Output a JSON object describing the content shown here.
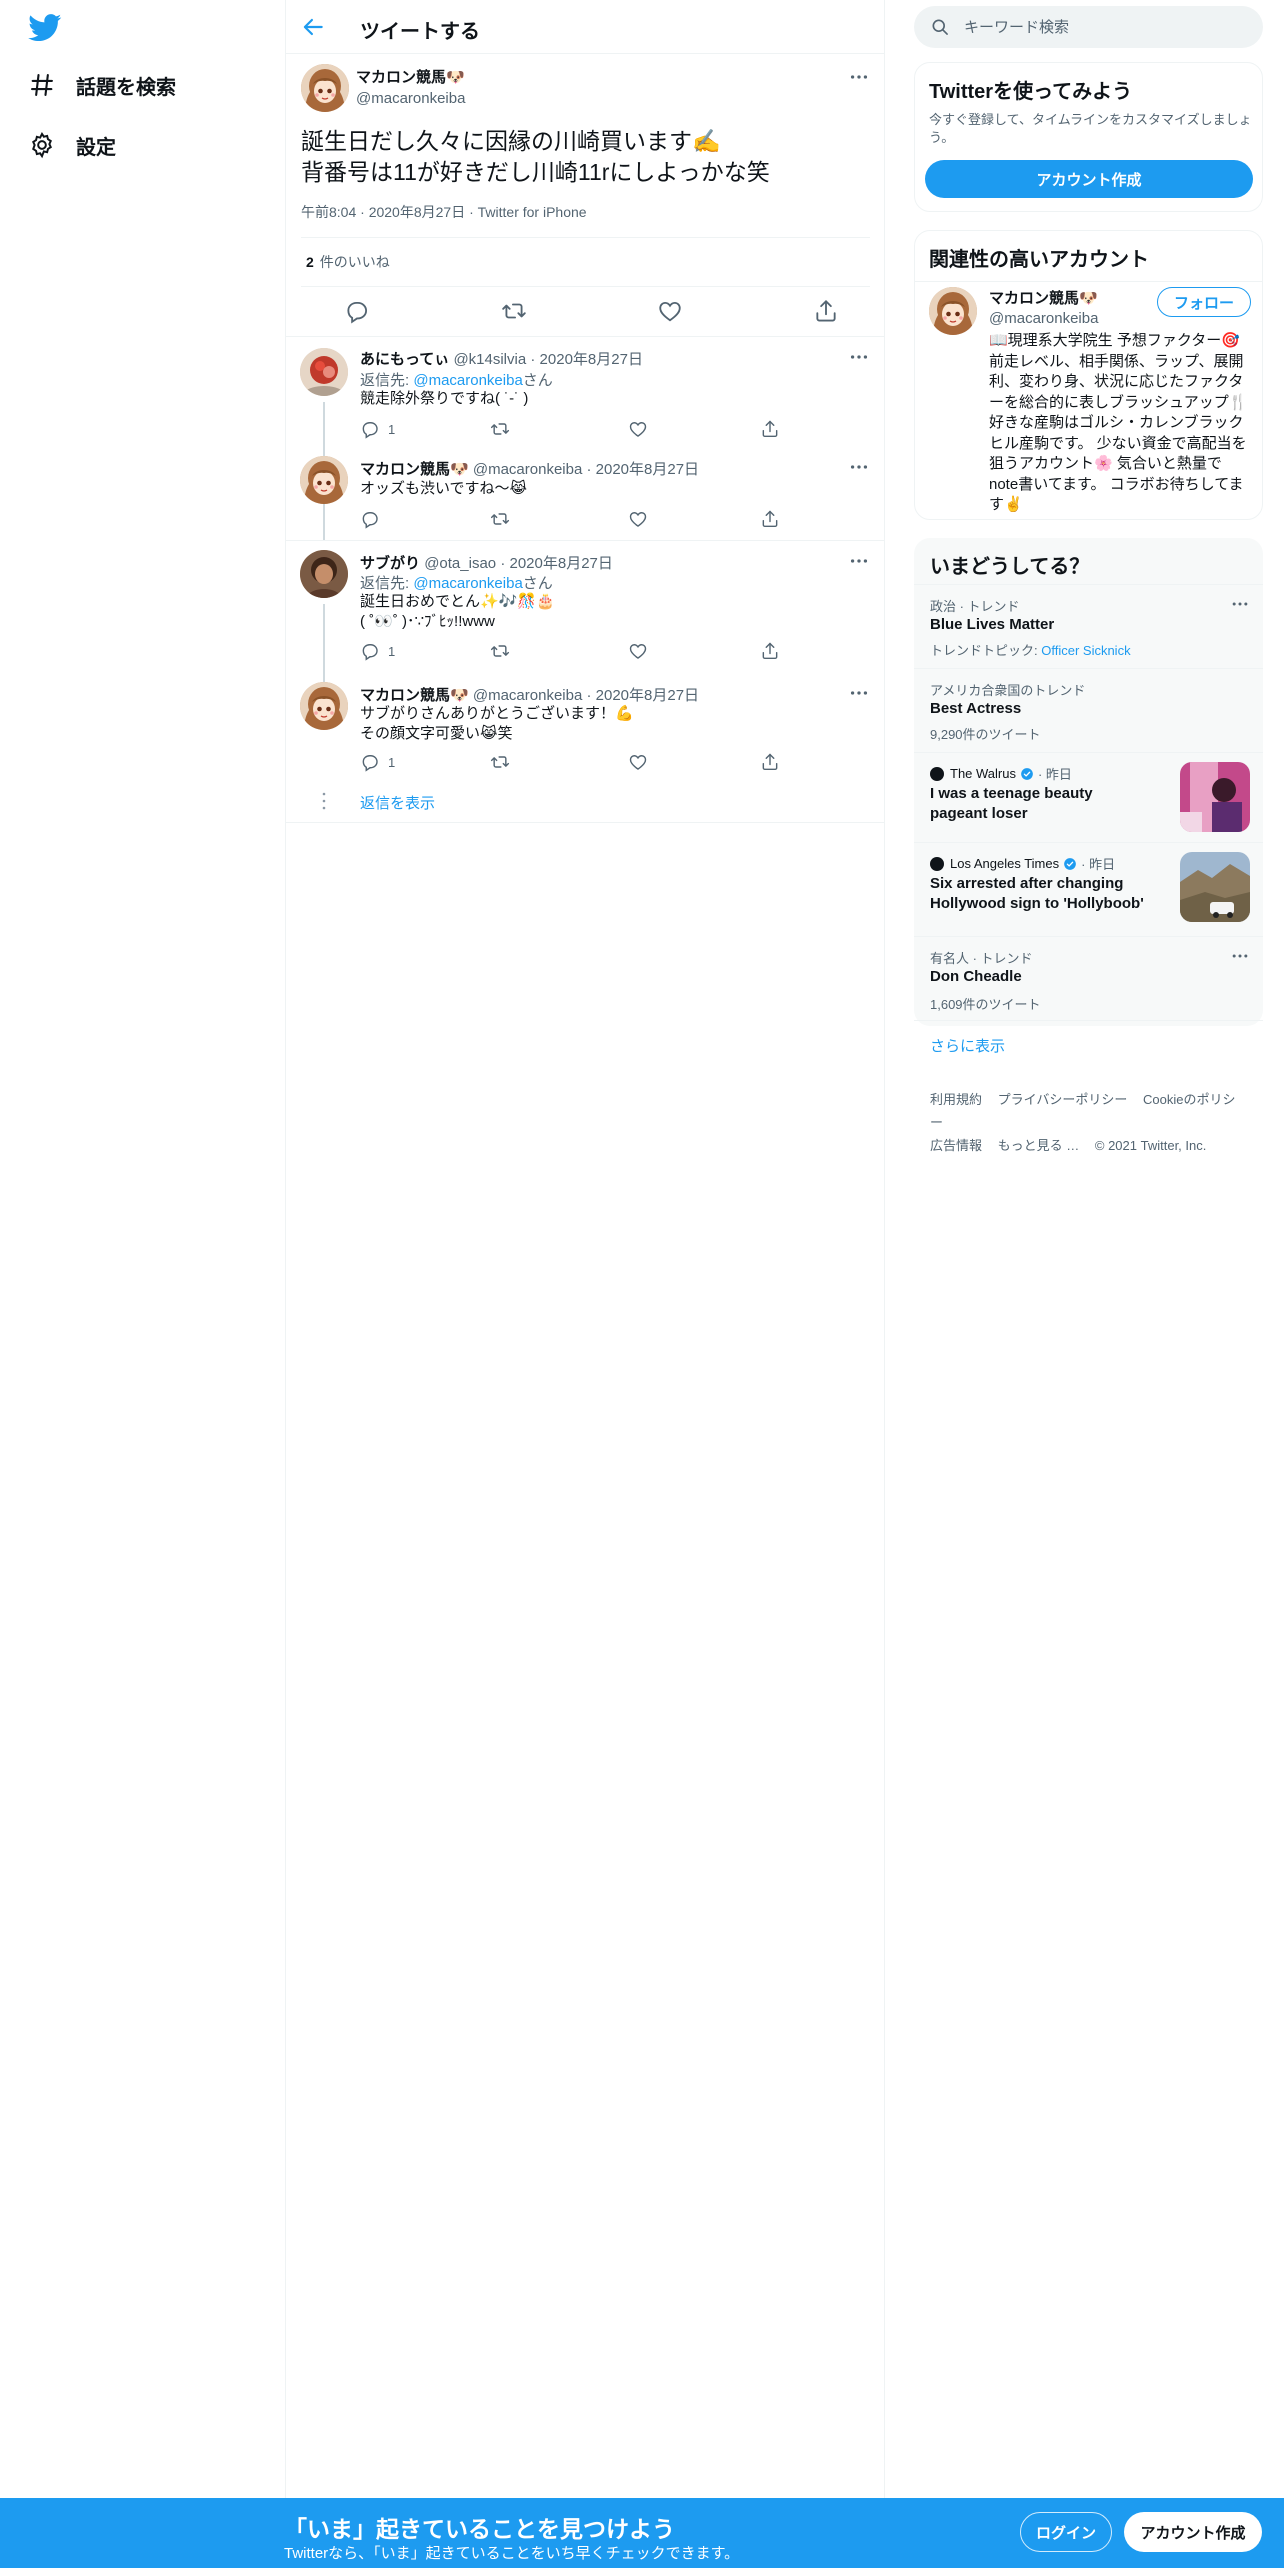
{
  "nav": {
    "explore_label": "話題を検索",
    "settings_label": "設定"
  },
  "header": {
    "title": "ツイートする"
  },
  "focus_tweet": {
    "name": "マカロン競馬🐶",
    "handle": "@macaronkeiba",
    "text_line1": "誕生日だし久々に因縁の川崎買います✍️",
    "text_line2": "背番号は11が好きだし川崎11rにしよっかな笑",
    "meta": "午前8:04 · 2020年8月27日 · Twitter for iPhone",
    "likes_count": "2",
    "likes_label": "件のいいね"
  },
  "replies": [
    {
      "name": "あにもってぃ",
      "handle": "@k14silvia",
      "date": "2020年8月27日",
      "reply_to_prefix": "返信先: ",
      "reply_to_handle": "@macaronkeiba",
      "reply_to_suffix": "さん",
      "text": "競走除外祭りですね( ˙-˙ )",
      "reply_count": "1"
    },
    {
      "name": "マカロン競馬🐶",
      "handle": "@macaronkeiba",
      "date": "2020年8月27日",
      "text": "オッズも渋いですね〜😹",
      "reply_count": ""
    },
    {
      "name": "サブがり",
      "handle": "@ota_isao",
      "date": "2020年8月27日",
      "reply_to_prefix": "返信先: ",
      "reply_to_handle": "@macaronkeiba",
      "reply_to_suffix": "さん",
      "text": "誕生日おめでとん✨🎶🎊🎂",
      "text2": "( ˚👀˚ )･∵ﾌﾞﾋｯ!!www",
      "reply_count": "1"
    },
    {
      "name": "マカロン競馬🐶",
      "handle": "@macaronkeiba",
      "date": "2020年8月27日",
      "text": "サブがりさんありがとうございます！💪",
      "text2": "その顔文字可愛い😹笑",
      "reply_count": "1"
    }
  ],
  "show_replies": "返信を表示",
  "search": {
    "placeholder": "キーワード検索"
  },
  "signup_card": {
    "title": "Twitterを使ってみよう",
    "desc": "今すぐ登録して、タイムラインをカスタマイズしましょう。",
    "button": "アカウント作成"
  },
  "related": {
    "title": "関連性の高いアカウント",
    "name": "マカロン競馬🐶",
    "handle": "@macaronkeiba",
    "follow": "フォロー",
    "bio": "📖現理系大学院生 予想ファクター🎯前走レベル、相手関係、ラップ、展開利、変わり身、状況に応じたファクターを総合的に表しブラッシュアップ🍴 好きな産駒はゴルシ・カレンブラックヒル産駒です。 少ない資金で高配当を狙うアカウント🌸 気合いと熱量でnote書いてます。 コラボお待ちしてます✌️"
  },
  "trends": {
    "title": "いまどうしてる？",
    "items": [
      {
        "context": "政治 · トレンド",
        "name": "Blue Lives Matter",
        "sub_prefix": "トレンドトピック: ",
        "sub_link": "Officer Sicknick"
      },
      {
        "context": "アメリカ合衆国のトレンド",
        "name": "Best Actress",
        "sub": "9,290件のツイート"
      },
      {
        "context": "有名人 · トレンド",
        "name": "Don Cheadle",
        "sub": "1,609件のツイート"
      }
    ],
    "news": [
      {
        "source": "The Walrus",
        "time": "· 昨日",
        "headline": "I was a teenage beauty pageant loser"
      },
      {
        "source": "Los Angeles Times",
        "time": "· 昨日",
        "headline": "Six arrested after changing Hollywood sign to 'Hollyboob'"
      }
    ],
    "show_more": "さらに表示"
  },
  "footer": {
    "links": [
      "利用規約",
      "プライバシーポリシー",
      "Cookieのポリシー",
      "広告情報",
      "もっと見る …"
    ],
    "copyright": "© 2021 Twitter, Inc."
  },
  "bottom_bar": {
    "title": "「いま」起きていることを見つけよう",
    "subtitle": "Twitterなら、「いま」起きていることをいち早くチェックできます。",
    "login": "ログイン",
    "signup": "アカウント作成"
  },
  "colors": {
    "accent": "#1d9bf0",
    "text": "#0f1419",
    "muted": "#536471",
    "border": "#eff3f4"
  }
}
